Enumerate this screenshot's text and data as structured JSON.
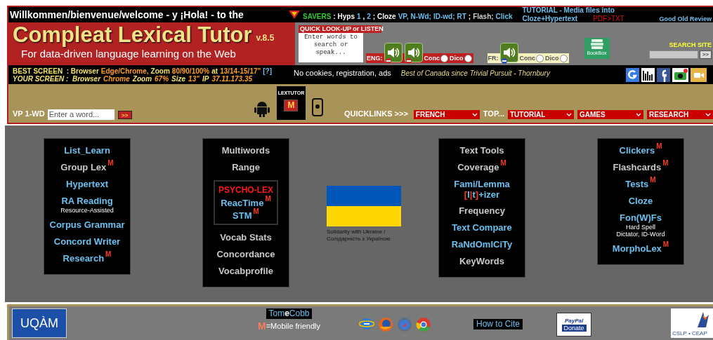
{
  "top_bar": {
    "welcome": "Willkommen/bienvenue/welcome - y ¡Hola! - to the",
    "savers": [
      {
        "text": "SAVERS",
        "kind": "label"
      },
      {
        "text": ": Hyps",
        "kind": "text"
      },
      {
        "text": "1",
        "kind": "link"
      },
      {
        "text": ",",
        "kind": "text"
      },
      {
        "text": "2",
        "kind": "link"
      },
      {
        "text": "; Cloze",
        "kind": "text"
      },
      {
        "text": "VP,",
        "kind": "link"
      },
      {
        "text": "N-Wd;",
        "kind": "link"
      },
      {
        "text": "ID-wd;",
        "kind": "link"
      },
      {
        "text": "RT",
        "kind": "link"
      },
      {
        "text": ";",
        "kind": "text"
      },
      {
        "text": "Flash;",
        "kind": "dim"
      },
      {
        "text": "Click",
        "kind": "link"
      }
    ],
    "tutorial_line_1": "TUTORIAL - Media files into",
    "tutorial_line_2": "Cloze+Hypertext",
    "pdf_link": "PDF>TXT",
    "review_link": "Good Old Review"
  },
  "title": {
    "name": "Compleat Lexical Tutor",
    "version": "v.8.5",
    "subtitle": "For data-driven language learning on the Web"
  },
  "quick_lookup": {
    "label": "QUICK LOOK-UP or LISTEN",
    "placeholder": "Enter words to search or speak...",
    "groups": [
      {
        "kind": "eng",
        "label": "ENG:",
        "options": [
          {
            "label": "Conc",
            "checked": false
          },
          {
            "label": "Dico",
            "checked": false
          }
        ]
      },
      {
        "kind": "fr",
        "label": "FR:",
        "options": [
          {
            "label": "Conc",
            "checked": false
          },
          {
            "label": "Dico",
            "checked": false
          }
        ]
      }
    ],
    "bookbox": "BookBox"
  },
  "search_site": {
    "label": "SEARCH SITE",
    "button": ">>"
  },
  "info_bar": {
    "best_screen": [
      {
        "text": "BEST SCREEN  : Browser",
        "kind": "label"
      },
      {
        "text": "Edge/Chrome,",
        "kind": "value"
      },
      {
        "text": "Zoom",
        "kind": "label"
      },
      {
        "text": "80/90/100%",
        "kind": "value"
      },
      {
        "text": "at",
        "kind": "label"
      },
      {
        "text": "13/14-15/17\"",
        "kind": "value"
      },
      {
        "text": "[?]",
        "kind": "link"
      }
    ],
    "your_screen": [
      {
        "text": "YOUR SCREEN :  Browser",
        "kind": "label"
      },
      {
        "text": "Chrome",
        "kind": "value"
      },
      {
        "text": "Zoom",
        "kind": "label"
      },
      {
        "text": "67%",
        "kind": "value"
      },
      {
        "text": "Size",
        "kind": "label"
      },
      {
        "text": "13\"",
        "kind": "value"
      },
      {
        "text": "IP",
        "kind": "label"
      },
      {
        "text": "37.11.173.35",
        "kind": "value"
      }
    ],
    "notice": "No cookies, registration, ads",
    "tagline": "Best of Canada since Trivial Pursuit - Thornbury"
  },
  "nav_bar": {
    "vp_label": "VP 1-WD",
    "vp_placeholder": "Enter a word...",
    "vp_button": ">>",
    "app_label": "LEXTUTOR",
    "app_badge": "M",
    "quicklinks_label": "QUICKLINKS >>>",
    "top_label": "TOP...",
    "selects": [
      {
        "value": "FRENCH"
      },
      {
        "kind": "top"
      },
      {
        "value": "TUTORIAL"
      },
      {
        "value": "GAMES"
      },
      {
        "value": "RESEARCH"
      }
    ]
  },
  "columns": [
    {
      "items": [
        {
          "label": "List_Learn",
          "kind": "link"
        },
        {
          "label": "Group Lex",
          "kind": "plain",
          "badge": "M"
        },
        {
          "label": "Hypertext",
          "kind": "link"
        },
        {
          "label": "RA Reading",
          "kind": "link",
          "sub": [
            "Resource-Assisted"
          ]
        },
        {
          "label": "Corpus Grammar",
          "kind": "link"
        },
        {
          "label": "Concord Writer",
          "kind": "link"
        },
        {
          "label": "Research",
          "kind": "link",
          "badge": "M"
        }
      ]
    },
    {
      "items": [
        {
          "label": "Multiwords",
          "kind": "plain"
        },
        {
          "label": "Range",
          "kind": "plain"
        },
        {
          "kind": "group",
          "heading": "PSYCHO-LEX",
          "items": [
            {
              "label": "ReacTime",
              "kind": "link",
              "badge": "M"
            },
            {
              "label": "STM",
              "kind": "link",
              "badge": "M"
            }
          ]
        },
        {
          "label": "Vocab Stats",
          "kind": "plain"
        },
        {
          "label": "Concordance",
          "kind": "plain"
        },
        {
          "label": "Vocabprofile",
          "kind": "plain"
        }
      ]
    },
    {
      "kind": "flag",
      "caption_1": "Solidarity with Ukraine /",
      "caption_2": "Солідарність з Україною"
    },
    {
      "items": [
        {
          "label": "Text Tools",
          "kind": "plain"
        },
        {
          "label": "Coverage",
          "kind": "plain",
          "badge": "M"
        },
        {
          "label": "Fami/Lemma",
          "kind": "link",
          "parts": [
            {
              "text": "[",
              "kind": "mark"
            },
            {
              "text": "l",
              "kind": "text"
            },
            {
              "text": "|",
              "kind": "mark"
            },
            {
              "text": "t",
              "kind": "text"
            },
            {
              "text": "]",
              "kind": "mark"
            },
            {
              "text": "+izer",
              "kind": "text"
            }
          ]
        },
        {
          "label": "Frequency",
          "kind": "plain"
        },
        {
          "label": "Text Compare",
          "kind": "link"
        },
        {
          "label": "RaNdOmICiTy",
          "kind": "link"
        },
        {
          "label": "KeyWords",
          "kind": "plain"
        }
      ]
    },
    {
      "items": [
        {
          "label": "Clickers",
          "kind": "link",
          "badge": "M"
        },
        {
          "label": "Flashcards",
          "kind": "plain",
          "badge": "M"
        },
        {
          "label": "Tests",
          "kind": "link",
          "badge": "M"
        },
        {
          "label": "Cloze",
          "kind": "link"
        },
        {
          "label": "Fon(W)Fs",
          "kind": "link",
          "sub": [
            "Hard Spell",
            "Dictator, ID-Word"
          ]
        },
        {
          "label": "MorphoLex",
          "kind": "link",
          "badge": "M"
        }
      ]
    }
  ],
  "footer": {
    "logo": "UQÀM",
    "author": [
      {
        "text": "Tom",
        "kind": "text"
      },
      {
        "text": "e",
        "kind": "mark"
      },
      {
        "text": "Cobb",
        "kind": "text"
      }
    ],
    "mobile_badge": "M",
    "mobile_note": "=Mobile friendly",
    "cite": "How to Cite",
    "paypal": "PayPal",
    "donate": "Donate",
    "partner_logo": "CSLP • CEAP"
  }
}
